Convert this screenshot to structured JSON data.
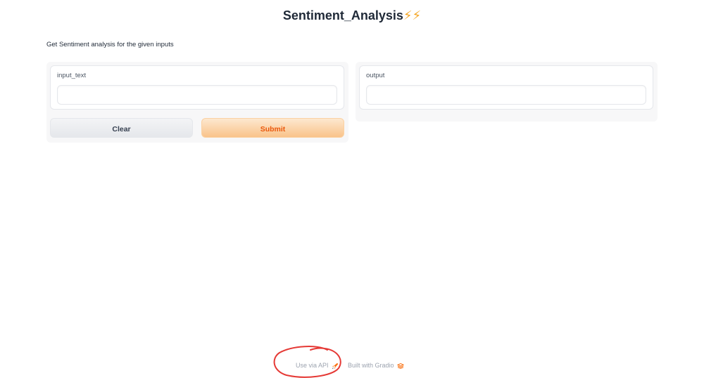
{
  "header": {
    "title": "Sentiment_Analysis",
    "title_emoji": "⚡⚡"
  },
  "description": "Get Sentiment analysis for the given inputs",
  "inputs": {
    "label": "input_text",
    "value": "",
    "placeholder": ""
  },
  "outputs": {
    "label": "output",
    "value": ""
  },
  "buttons": {
    "clear_label": "Clear",
    "submit_label": "Submit"
  },
  "footer": {
    "api_label": "Use via API",
    "api_icon": "rocket-icon",
    "built_label": "Built with Gradio",
    "built_icon": "gradio-logo-icon"
  },
  "colors": {
    "accent": "#ea580c",
    "submit_bg": "#f9c38a",
    "annotation": "#e53935"
  }
}
